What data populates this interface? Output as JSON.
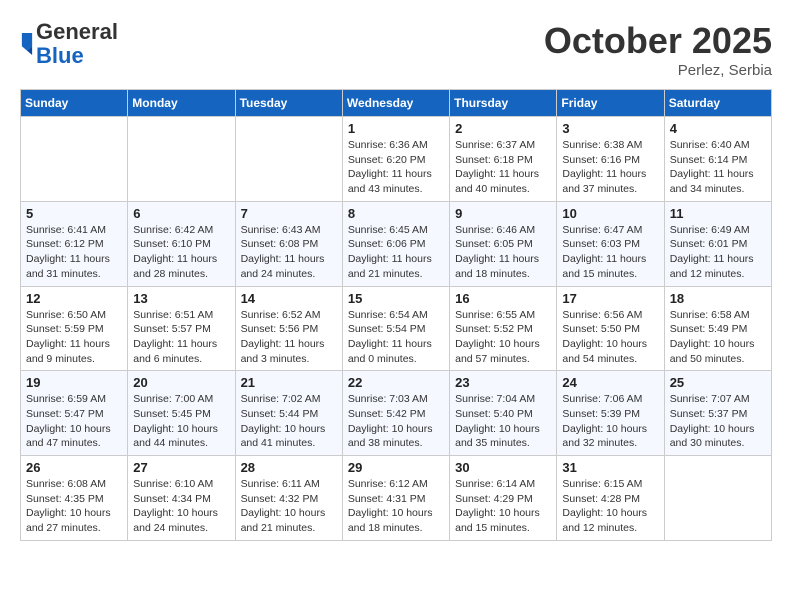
{
  "header": {
    "logo": {
      "general": "General",
      "blue": "Blue"
    },
    "title": "October 2025",
    "location": "Perlez, Serbia"
  },
  "weekdays": [
    "Sunday",
    "Monday",
    "Tuesday",
    "Wednesday",
    "Thursday",
    "Friday",
    "Saturday"
  ],
  "weeks": [
    [
      null,
      null,
      null,
      {
        "day": "1",
        "sunrise": "6:36 AM",
        "sunset": "6:20 PM",
        "daylight": "11 hours and 43 minutes."
      },
      {
        "day": "2",
        "sunrise": "6:37 AM",
        "sunset": "6:18 PM",
        "daylight": "11 hours and 40 minutes."
      },
      {
        "day": "3",
        "sunrise": "6:38 AM",
        "sunset": "6:16 PM",
        "daylight": "11 hours and 37 minutes."
      },
      {
        "day": "4",
        "sunrise": "6:40 AM",
        "sunset": "6:14 PM",
        "daylight": "11 hours and 34 minutes."
      }
    ],
    [
      {
        "day": "5",
        "sunrise": "6:41 AM",
        "sunset": "6:12 PM",
        "daylight": "11 hours and 31 minutes."
      },
      {
        "day": "6",
        "sunrise": "6:42 AM",
        "sunset": "6:10 PM",
        "daylight": "11 hours and 28 minutes."
      },
      {
        "day": "7",
        "sunrise": "6:43 AM",
        "sunset": "6:08 PM",
        "daylight": "11 hours and 24 minutes."
      },
      {
        "day": "8",
        "sunrise": "6:45 AM",
        "sunset": "6:06 PM",
        "daylight": "11 hours and 21 minutes."
      },
      {
        "day": "9",
        "sunrise": "6:46 AM",
        "sunset": "6:05 PM",
        "daylight": "11 hours and 18 minutes."
      },
      {
        "day": "10",
        "sunrise": "6:47 AM",
        "sunset": "6:03 PM",
        "daylight": "11 hours and 15 minutes."
      },
      {
        "day": "11",
        "sunrise": "6:49 AM",
        "sunset": "6:01 PM",
        "daylight": "11 hours and 12 minutes."
      }
    ],
    [
      {
        "day": "12",
        "sunrise": "6:50 AM",
        "sunset": "5:59 PM",
        "daylight": "11 hours and 9 minutes."
      },
      {
        "day": "13",
        "sunrise": "6:51 AM",
        "sunset": "5:57 PM",
        "daylight": "11 hours and 6 minutes."
      },
      {
        "day": "14",
        "sunrise": "6:52 AM",
        "sunset": "5:56 PM",
        "daylight": "11 hours and 3 minutes."
      },
      {
        "day": "15",
        "sunrise": "6:54 AM",
        "sunset": "5:54 PM",
        "daylight": "11 hours and 0 minutes."
      },
      {
        "day": "16",
        "sunrise": "6:55 AM",
        "sunset": "5:52 PM",
        "daylight": "10 hours and 57 minutes."
      },
      {
        "day": "17",
        "sunrise": "6:56 AM",
        "sunset": "5:50 PM",
        "daylight": "10 hours and 54 minutes."
      },
      {
        "day": "18",
        "sunrise": "6:58 AM",
        "sunset": "5:49 PM",
        "daylight": "10 hours and 50 minutes."
      }
    ],
    [
      {
        "day": "19",
        "sunrise": "6:59 AM",
        "sunset": "5:47 PM",
        "daylight": "10 hours and 47 minutes."
      },
      {
        "day": "20",
        "sunrise": "7:00 AM",
        "sunset": "5:45 PM",
        "daylight": "10 hours and 44 minutes."
      },
      {
        "day": "21",
        "sunrise": "7:02 AM",
        "sunset": "5:44 PM",
        "daylight": "10 hours and 41 minutes."
      },
      {
        "day": "22",
        "sunrise": "7:03 AM",
        "sunset": "5:42 PM",
        "daylight": "10 hours and 38 minutes."
      },
      {
        "day": "23",
        "sunrise": "7:04 AM",
        "sunset": "5:40 PM",
        "daylight": "10 hours and 35 minutes."
      },
      {
        "day": "24",
        "sunrise": "7:06 AM",
        "sunset": "5:39 PM",
        "daylight": "10 hours and 32 minutes."
      },
      {
        "day": "25",
        "sunrise": "7:07 AM",
        "sunset": "5:37 PM",
        "daylight": "10 hours and 30 minutes."
      }
    ],
    [
      {
        "day": "26",
        "sunrise": "6:08 AM",
        "sunset": "4:35 PM",
        "daylight": "10 hours and 27 minutes."
      },
      {
        "day": "27",
        "sunrise": "6:10 AM",
        "sunset": "4:34 PM",
        "daylight": "10 hours and 24 minutes."
      },
      {
        "day": "28",
        "sunrise": "6:11 AM",
        "sunset": "4:32 PM",
        "daylight": "10 hours and 21 minutes."
      },
      {
        "day": "29",
        "sunrise": "6:12 AM",
        "sunset": "4:31 PM",
        "daylight": "10 hours and 18 minutes."
      },
      {
        "day": "30",
        "sunrise": "6:14 AM",
        "sunset": "4:29 PM",
        "daylight": "10 hours and 15 minutes."
      },
      {
        "day": "31",
        "sunrise": "6:15 AM",
        "sunset": "4:28 PM",
        "daylight": "10 hours and 12 minutes."
      },
      null
    ]
  ]
}
